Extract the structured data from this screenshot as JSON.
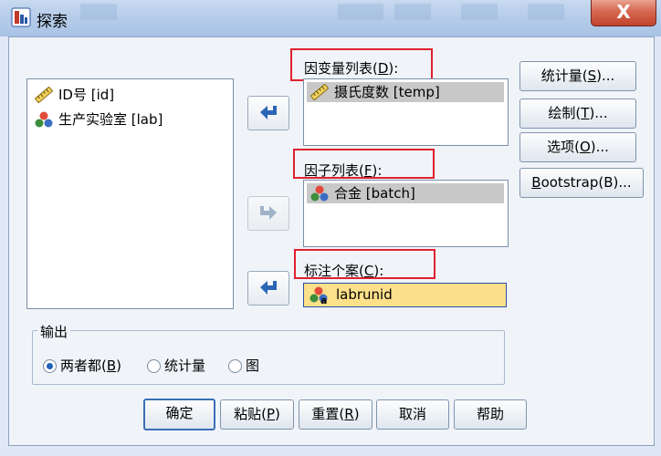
{
  "window": {
    "title": "探索",
    "close_symbol": "X"
  },
  "source_list": {
    "items": [
      {
        "label": "ID号 [id]",
        "icon": "ruler-icon"
      },
      {
        "label": "生产实验室 [lab]",
        "icon": "nominal-icon"
      }
    ]
  },
  "dependent": {
    "label_text": "因变量列表(",
    "label_key": "D",
    "label_suffix": "):",
    "items": [
      {
        "label": "摄氏度数 [temp]",
        "icon": "ruler-icon"
      }
    ]
  },
  "factor": {
    "label_text": "因子列表(",
    "label_key": "F",
    "label_suffix": "):",
    "items": [
      {
        "label": "合金 [batch]",
        "icon": "nominal-icon"
      }
    ]
  },
  "label_cases": {
    "label_text": "标注个案(",
    "label_key": "C",
    "label_suffix": "):",
    "value": "labrunid",
    "icon": "nominal-string-icon"
  },
  "side_buttons": [
    {
      "pre": "统计量(",
      "key": "S",
      "post": ")..."
    },
    {
      "pre": "绘制(",
      "key": "T",
      "post": ")..."
    },
    {
      "pre": "选项(",
      "key": "O",
      "post": ")..."
    },
    {
      "pre": "",
      "key": "B",
      "post": "ootstrap(B)..."
    }
  ],
  "output": {
    "legend": "输出",
    "options": [
      {
        "pre": "两者都(",
        "key": "B",
        "post": ")",
        "selected": true
      },
      {
        "pre": "统计量",
        "key": "",
        "post": "",
        "selected": false
      },
      {
        "pre": "图",
        "key": "",
        "post": "",
        "selected": false
      }
    ]
  },
  "bottom_buttons": [
    {
      "pre": "确定",
      "key": "",
      "post": "",
      "default": true
    },
    {
      "pre": "粘贴(",
      "key": "P",
      "post": ")",
      "default": false
    },
    {
      "pre": "重置(",
      "key": "R",
      "post": ")",
      "default": false
    },
    {
      "pre": "取消",
      "key": "",
      "post": "",
      "default": false
    },
    {
      "pre": "帮助",
      "key": "",
      "post": "",
      "default": false
    }
  ],
  "colors": {
    "accent": "#2b66b6",
    "selection": "#c8c8c8",
    "highlight_field": "#fde08a",
    "annotation": "#e0202e"
  }
}
